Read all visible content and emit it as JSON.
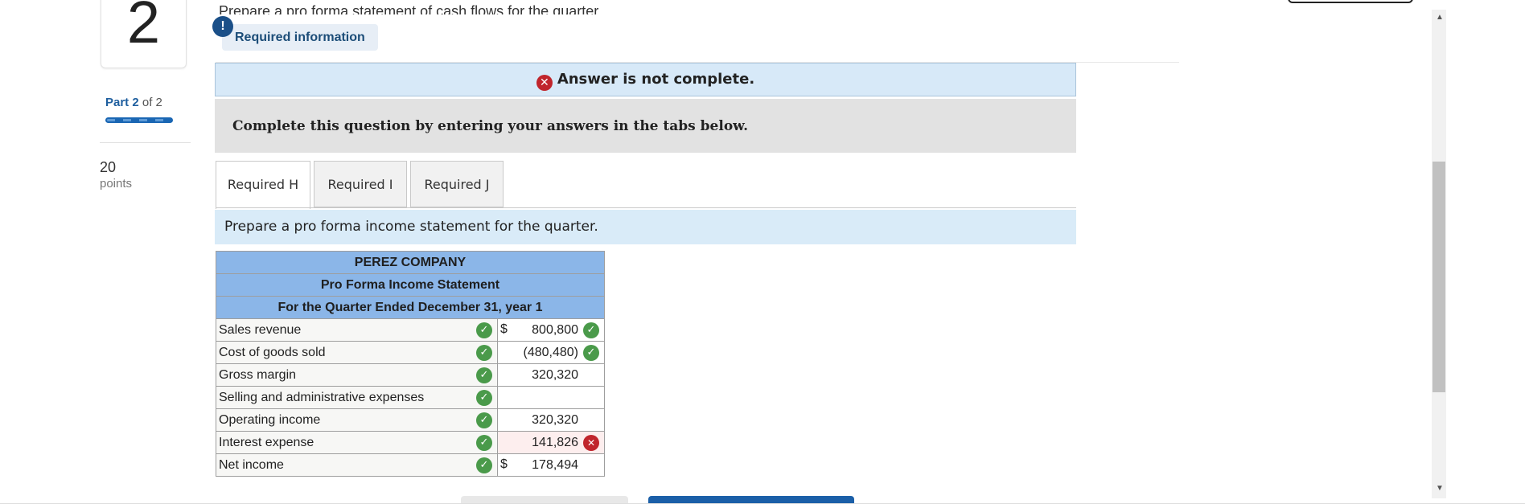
{
  "question": {
    "number": "2",
    "part_label_bold": "Part 2",
    "part_label_rest": "of 2",
    "progress": 1.0,
    "points_value": "20",
    "points_label": "points"
  },
  "header": {
    "cut_text": "Prepare a pro forma statement of cash flows for the quarter.",
    "required_info_badge": "Required information",
    "alert_glyph": "!"
  },
  "answer_banner": {
    "text": "Answer is not complete.",
    "icon": "x-circle-icon"
  },
  "instruction_box": "Complete this question by entering your answers in the tabs below.",
  "tabs": [
    {
      "label": "Required H",
      "active": true
    },
    {
      "label": "Required I",
      "active": false
    },
    {
      "label": "Required J",
      "active": false
    }
  ],
  "tab_instruction": "Prepare a pro forma income statement for the quarter.",
  "statement": {
    "company": "PEREZ COMPANY",
    "title": "Pro Forma Income Statement",
    "period": "For the Quarter Ended December 31, year 1",
    "rows": [
      {
        "label": "Sales revenue",
        "dollar": "$",
        "value": "800,800",
        "label_status": "correct",
        "value_status": "correct"
      },
      {
        "label": "Cost of goods sold",
        "dollar": "",
        "value": "(480,480)",
        "label_status": "correct",
        "value_status": "correct"
      },
      {
        "label": "Gross margin",
        "dollar": "",
        "value": "320,320",
        "label_status": "correct",
        "value_status": "none"
      },
      {
        "label": "Selling and administrative expenses",
        "dollar": "",
        "value": "",
        "label_status": "correct",
        "value_status": "none"
      },
      {
        "label": "Operating income",
        "dollar": "",
        "value": "320,320",
        "label_status": "correct",
        "value_status": "none"
      },
      {
        "label": "Interest expense",
        "dollar": "",
        "value": "141,826",
        "label_status": "correct",
        "value_status": "incorrect"
      },
      {
        "label": "Net income",
        "dollar": "$",
        "value": "178,494",
        "label_status": "correct",
        "value_status": "none"
      }
    ]
  },
  "colors": {
    "accent": "#1a66b3",
    "correct": "#4a9a4a",
    "incorrect": "#c0252c",
    "table_header": "#8bb6e8",
    "banner": "#d7e9f8"
  }
}
